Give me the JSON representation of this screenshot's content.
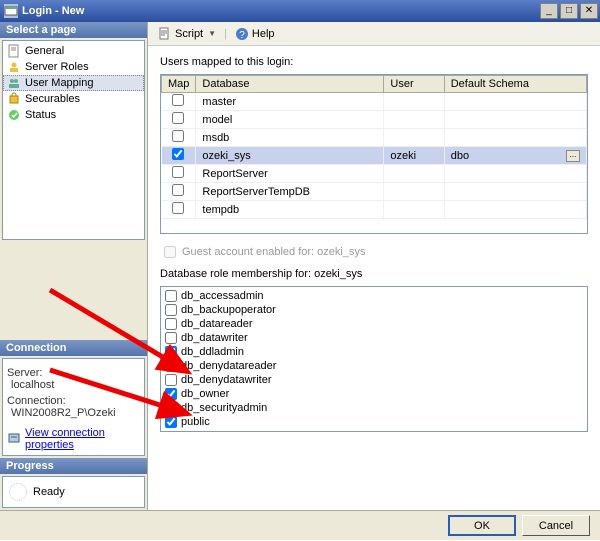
{
  "window": {
    "title": "Login - New"
  },
  "toolbar": {
    "script": "Script",
    "help": "Help"
  },
  "pages": {
    "items": [
      {
        "label": "General"
      },
      {
        "label": "Server Roles"
      },
      {
        "label": "User Mapping"
      },
      {
        "label": "Securables"
      },
      {
        "label": "Status"
      }
    ],
    "selected": 2
  },
  "connection": {
    "header": "Connection",
    "server_label": "Server:",
    "server_value": "localhost",
    "conn_label": "Connection:",
    "conn_value": "WIN2008R2_P\\Ozeki",
    "link": "View connection properties"
  },
  "progress": {
    "header": "Progress",
    "status": "Ready"
  },
  "pagesel": {
    "header": "Select a page"
  },
  "mapping": {
    "label": "Users mapped to this login:",
    "columns": {
      "map": "Map",
      "db": "Database",
      "user": "User",
      "schema": "Default Schema"
    },
    "rows": [
      {
        "checked": false,
        "db": "master",
        "user": "",
        "schema": "",
        "sel": false
      },
      {
        "checked": false,
        "db": "model",
        "user": "",
        "schema": "",
        "sel": false
      },
      {
        "checked": false,
        "db": "msdb",
        "user": "",
        "schema": "",
        "sel": false
      },
      {
        "checked": true,
        "db": "ozeki_sys",
        "user": "ozeki",
        "schema": "dbo",
        "sel": true
      },
      {
        "checked": false,
        "db": "ReportServer",
        "user": "",
        "schema": "",
        "sel": false
      },
      {
        "checked": false,
        "db": "ReportServerTempDB",
        "user": "",
        "schema": "",
        "sel": false
      },
      {
        "checked": false,
        "db": "tempdb",
        "user": "",
        "schema": "",
        "sel": false
      }
    ]
  },
  "guest": {
    "label": "Guest account enabled for: ozeki_sys",
    "checked": false
  },
  "roles": {
    "label": "Database role membership for: ozeki_sys",
    "items": [
      {
        "name": "db_accessadmin",
        "checked": false
      },
      {
        "name": "db_backupoperator",
        "checked": false
      },
      {
        "name": "db_datareader",
        "checked": false
      },
      {
        "name": "db_datawriter",
        "checked": false
      },
      {
        "name": "db_ddladmin",
        "checked": true
      },
      {
        "name": "db_denydatareader",
        "checked": false
      },
      {
        "name": "db_denydatawriter",
        "checked": false
      },
      {
        "name": "db_owner",
        "checked": true
      },
      {
        "name": "db_securityadmin",
        "checked": false
      },
      {
        "name": "public",
        "checked": true
      }
    ]
  },
  "buttons": {
    "ok": "OK",
    "cancel": "Cancel"
  }
}
